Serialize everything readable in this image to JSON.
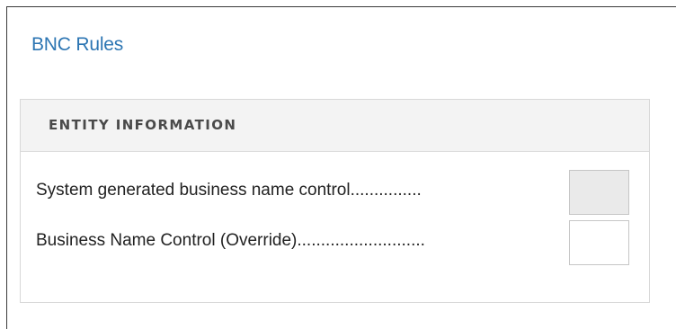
{
  "header": {
    "link_label": "BNC Rules"
  },
  "panel": {
    "title": "ENTITY INFORMATION",
    "fields": [
      {
        "label": "System generated business name control...............",
        "value": "",
        "disabled": true
      },
      {
        "label": "Business Name Control (Override)...........................",
        "value": "",
        "disabled": false
      }
    ]
  },
  "colors": {
    "link": "#2d76b3",
    "header_bg": "#f3f3f3",
    "disabled_input_bg": "#eaeaea"
  }
}
